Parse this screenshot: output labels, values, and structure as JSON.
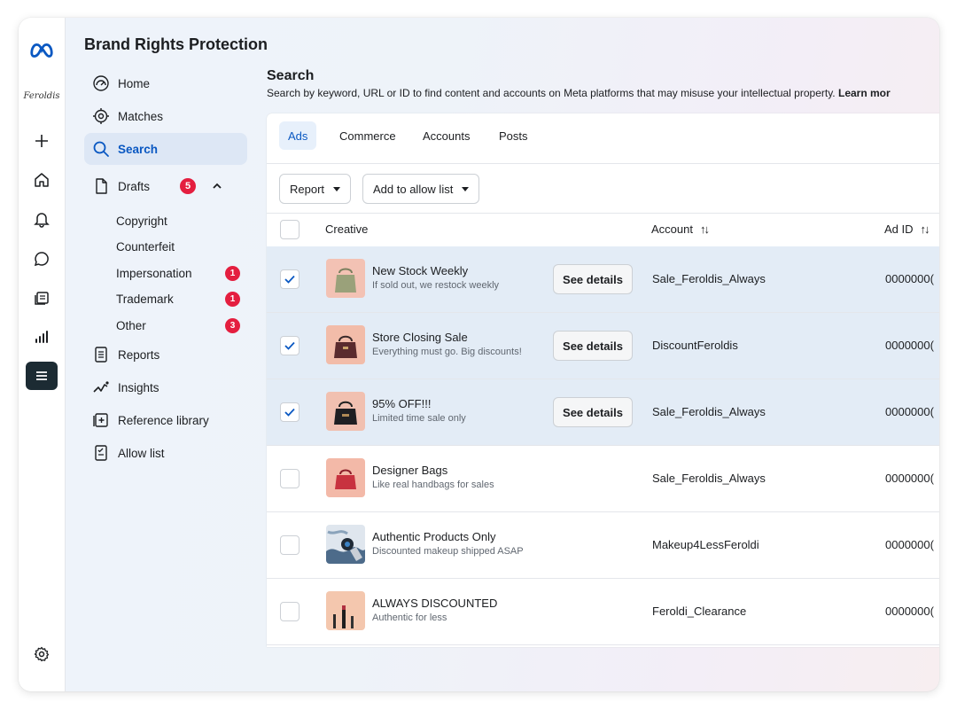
{
  "app": {
    "title": "Brand Rights Protection",
    "brand_mark": "Feroldis"
  },
  "nav": {
    "home": "Home",
    "matches": "Matches",
    "search": "Search",
    "drafts": "Drafts",
    "drafts_badge": "5",
    "drafts_sub": [
      {
        "label": "Copyright",
        "badge": ""
      },
      {
        "label": "Counterfeit",
        "badge": ""
      },
      {
        "label": "Impersonation",
        "badge": "1"
      },
      {
        "label": "Trademark",
        "badge": "1"
      },
      {
        "label": "Other",
        "badge": "3"
      }
    ],
    "reports": "Reports",
    "insights": "Insights",
    "reference_library": "Reference library",
    "allow_list": "Allow list"
  },
  "main": {
    "title": "Search",
    "description": "Search by keyword, URL or ID to find content and accounts on Meta platforms that may misuse your intellectual property.",
    "learn_more": "Learn mor",
    "tabs": [
      "Ads",
      "Commerce",
      "Accounts",
      "Posts"
    ],
    "active_tab": "Ads",
    "toolbar": {
      "report": "Report",
      "add_allow": "Add to allow list"
    },
    "columns": {
      "creative": "Creative",
      "account": "Account",
      "ad_id": "Ad ID"
    },
    "see_details": "See details",
    "rows": [
      {
        "checked": true,
        "title": "New Stock Weekly",
        "subtitle": "If sold out, we restock weekly",
        "details": true,
        "account": "Sale_Feroldis_Always",
        "ad_id": "0000000("
      },
      {
        "checked": true,
        "title": "Store Closing Sale",
        "subtitle": "Everything must go. Big discounts!",
        "details": true,
        "account": "DiscountFeroldis",
        "ad_id": "0000000("
      },
      {
        "checked": true,
        "title": "95% OFF!!!",
        "subtitle": "Limited time sale only",
        "details": true,
        "account": "Sale_Feroldis_Always",
        "ad_id": "0000000("
      },
      {
        "checked": false,
        "title": "Designer Bags",
        "subtitle": "Like real handbags for sales",
        "details": false,
        "account": "Sale_Feroldis_Always",
        "ad_id": "0000000("
      },
      {
        "checked": false,
        "title": "Authentic Products Only",
        "subtitle": "Discounted makeup shipped ASAP",
        "details": false,
        "account": "Makeup4LessFeroldi",
        "ad_id": "0000000("
      },
      {
        "checked": false,
        "title": "ALWAYS DISCOUNTED",
        "subtitle": "Authentic for less",
        "details": false,
        "account": "Feroldi_Clearance",
        "ad_id": "0000000("
      }
    ]
  },
  "colors": {
    "accent": "#0a58c2",
    "badge": "#e41e3f",
    "selected_row": "#e3ecf6",
    "rail_active": "#1c2b33"
  }
}
